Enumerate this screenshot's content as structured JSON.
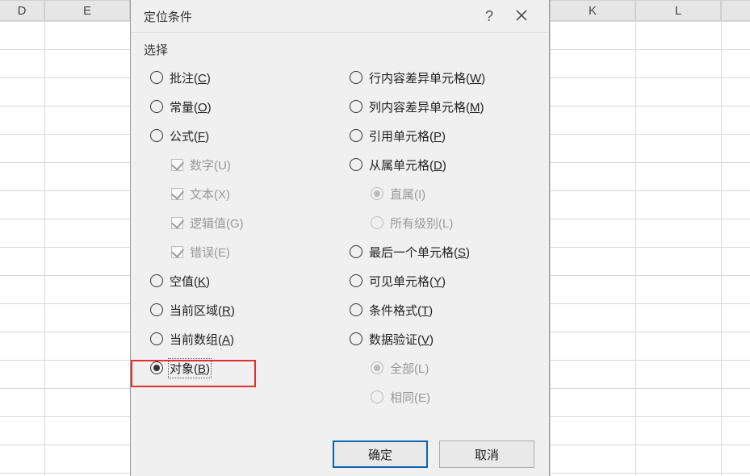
{
  "sheet": {
    "columns": [
      "D",
      "E",
      "K",
      "L"
    ]
  },
  "dialog": {
    "title": "定位条件",
    "help": "?",
    "close": "×",
    "section": "选择",
    "left": {
      "comments": "批注(C)",
      "constants": "常量(O)",
      "formulas": "公式(F)",
      "numbers": "数字(U)",
      "text": "文本(X)",
      "logicals": "逻辑值(G)",
      "errors": "错误(E)",
      "blanks": "空值(K)",
      "current_region": "当前区域(R)",
      "current_array": "当前数组(A)",
      "objects": "对象(B)"
    },
    "right": {
      "row_diff": "行内容差异单元格(W)",
      "col_diff": "列内容差异单元格(M)",
      "precedents": "引用单元格(P)",
      "dependents": "从属单元格(D)",
      "direct_only": "直属(I)",
      "all_levels": "所有级别(L)",
      "last_cell": "最后一个单元格(S)",
      "visible_cells": "可见单元格(Y)",
      "cond_fmt": "条件格式(T)",
      "data_val": "数据验证(V)",
      "all": "全部(L)",
      "same": "相同(E)"
    },
    "buttons": {
      "ok": "确定",
      "cancel": "取消"
    }
  }
}
